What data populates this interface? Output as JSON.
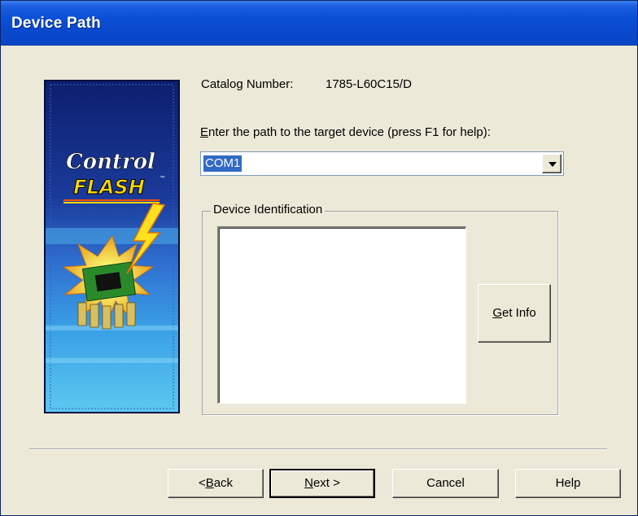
{
  "window": {
    "title": "Device Path"
  },
  "banner": {
    "logo_line1": "Control",
    "logo_line2": "FLASH",
    "logo_mark": "™"
  },
  "catalog": {
    "label": "Catalog Number:",
    "value": "1785-L60C15/D"
  },
  "path_prompt": {
    "mnemonic": "E",
    "rest": "nter the path to the target device (press F1 for help):"
  },
  "path_combo": {
    "selected": "COM1"
  },
  "device_id": {
    "group_label": "Device Identification",
    "list_items": []
  },
  "buttons": {
    "get_info": {
      "mnemonic": "G",
      "rest": "et Info"
    },
    "back": {
      "prefix": "< ",
      "mnemonic": "B",
      "rest": "ack"
    },
    "next": {
      "mnemonic": "N",
      "rest": "ext >"
    },
    "cancel": "Cancel",
    "help": "Help"
  },
  "colors": {
    "titlebar": "#0a4fd6",
    "face": "#ece9d8",
    "selection": "#316ac5"
  },
  "icons": [
    "control-flash-logo",
    "chip-lightning-icon",
    "dropdown-arrow-icon"
  ]
}
